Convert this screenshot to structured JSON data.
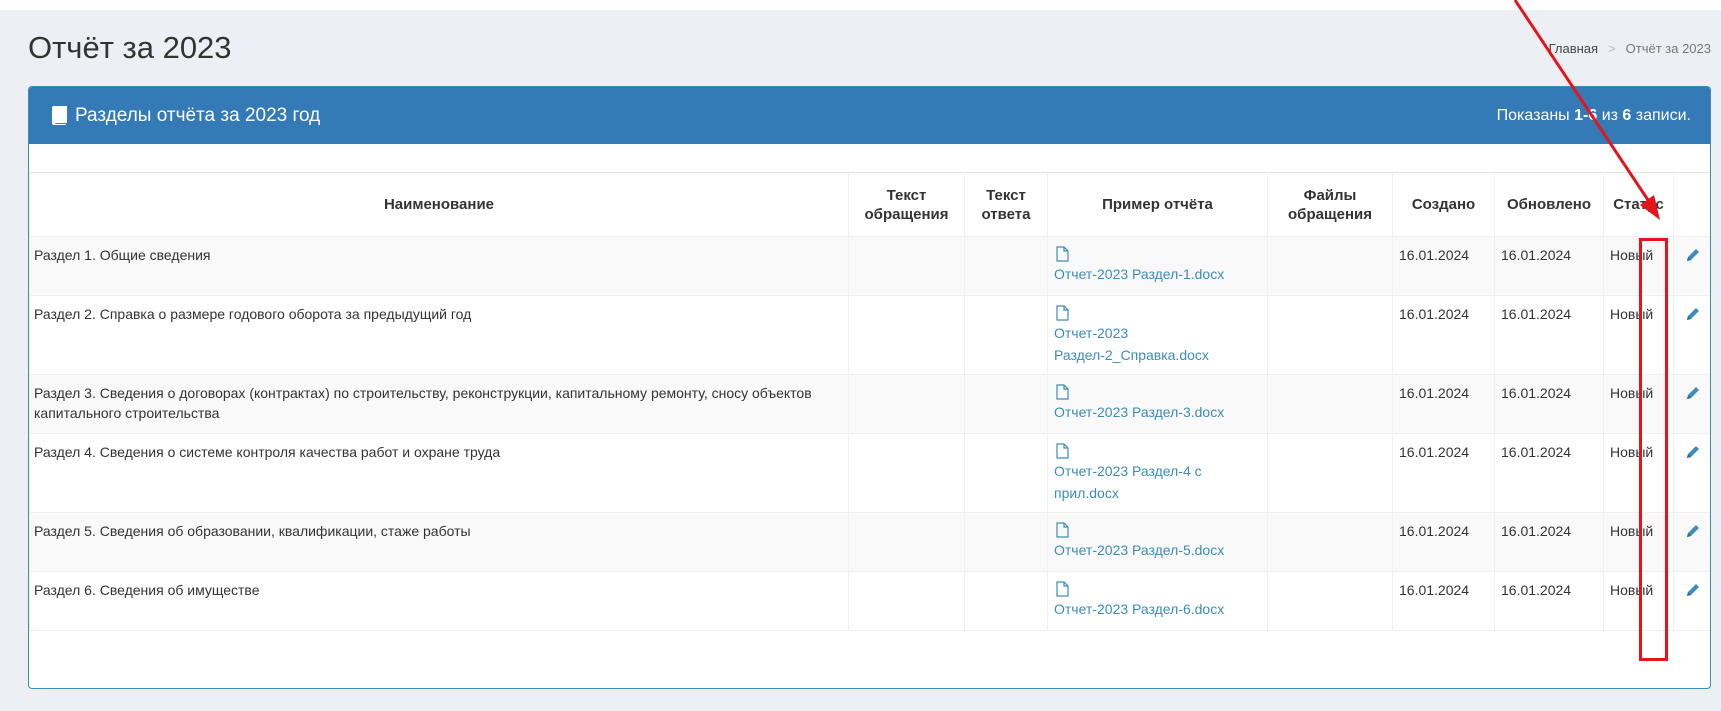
{
  "page": {
    "title": "Отчёт за 2023",
    "breadcrumb": {
      "home": "Главная",
      "separator": ">",
      "current": "Отчёт за 2023"
    }
  },
  "panel": {
    "title": "Разделы отчёта за 2023 год",
    "summary_prefix": "Показаны ",
    "summary_range": "1-6",
    "summary_mid": " из ",
    "summary_total": "6",
    "summary_suffix": " записи."
  },
  "table": {
    "columns": {
      "name": "Наименование",
      "request_text": "Текст обращения",
      "answer_text": "Текст ответа",
      "sample": "Пример отчёта",
      "request_files": "Файлы обращения",
      "created": "Создано",
      "updated": "Обновлено",
      "status": "Статус"
    },
    "rows": [
      {
        "name": "Раздел 1. Общие сведения",
        "file": "Отчет-2023 Раздел-1.docx",
        "created": "16.01.2024",
        "updated": "16.01.2024",
        "status": "Новый"
      },
      {
        "name": "Раздел 2. Справка о размере годового оборота за предыдущий год",
        "file": "Отчет-2023 Раздел-2_Справка.docx",
        "created": "16.01.2024",
        "updated": "16.01.2024",
        "status": "Новый"
      },
      {
        "name": "Раздел 3. Сведения о договорах (контрактах) по строительству, реконструкции, капитальному ремонту, сносу объектов капитального строительства",
        "file": "Отчет-2023 Раздел-3.docx",
        "created": "16.01.2024",
        "updated": "16.01.2024",
        "status": "Новый"
      },
      {
        "name": "Раздел 4. Сведения о системе контроля качества работ и охране труда",
        "file": "Отчет-2023 Раздел-4 с прил.docx",
        "created": "16.01.2024",
        "updated": "16.01.2024",
        "status": "Новый"
      },
      {
        "name": "Раздел 5. Сведения об образовании, квалификации, стаже работы",
        "file": "Отчет-2023 Раздел-5.docx",
        "created": "16.01.2024",
        "updated": "16.01.2024",
        "status": "Новый"
      },
      {
        "name": "Раздел 6. Сведения об имуществе",
        "file": "Отчет-2023 Раздел-6.docx",
        "created": "16.01.2024",
        "updated": "16.01.2024",
        "status": "Новый"
      }
    ]
  },
  "icons": {
    "panel": "book-icon",
    "file": "document-icon",
    "edit": "pencil-icon"
  },
  "colors": {
    "header_blue": "#337ab7",
    "link": "#3c8dbc",
    "annotation_red": "#e5141b",
    "background": "#ecf0f5"
  }
}
